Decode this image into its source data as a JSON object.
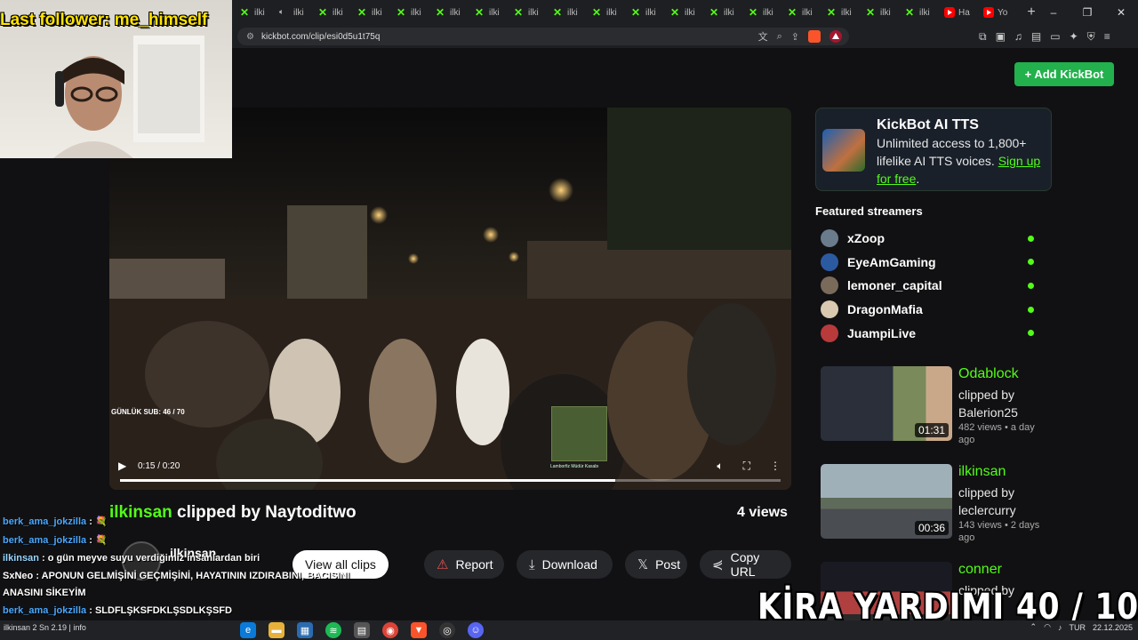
{
  "browser": {
    "tabs": [
      {
        "favicon": "kick-icon",
        "label": "ilki"
      },
      {
        "favicon": "speaker-icon",
        "label": "ilki"
      },
      {
        "favicon": "kick-icon",
        "label": "ilki"
      },
      {
        "favicon": "kick-icon",
        "label": "ilki"
      },
      {
        "favicon": "kick-icon",
        "label": "ilki"
      },
      {
        "favicon": "kick-icon",
        "label": "ilki"
      },
      {
        "favicon": "kick-icon",
        "label": "ilki"
      },
      {
        "favicon": "kick-icon",
        "label": "ilki"
      },
      {
        "favicon": "kick-icon",
        "label": "ilki"
      },
      {
        "favicon": "kick-icon",
        "label": "ilki"
      },
      {
        "favicon": "kick-icon",
        "label": "ilki"
      },
      {
        "favicon": "kick-icon",
        "label": "ilki"
      },
      {
        "favicon": "kick-icon",
        "label": "ilki"
      },
      {
        "favicon": "kick-icon",
        "label": "ilki"
      },
      {
        "favicon": "kick-icon",
        "label": "ilki"
      },
      {
        "favicon": "kick-icon",
        "label": "ilki"
      },
      {
        "favicon": "kick-icon",
        "label": "ilki"
      },
      {
        "favicon": "kick-icon",
        "label": "ilki"
      },
      {
        "favicon": "youtube-icon",
        "label": "Ha"
      },
      {
        "favicon": "youtube-icon",
        "label": "Yo"
      }
    ],
    "url": "kickbot.com/clip/esi0d5u1t75q"
  },
  "page": {
    "add_button": "+ Add KickBot",
    "video": {
      "time": "0:15 / 0:20",
      "progress": 0.75,
      "overlay_text": "GÜNLÜK SUB: 46 / 70",
      "overlay_caption": "Lamborfiz Müdür Kasabı"
    },
    "clip": {
      "channel": "ilkinsan",
      "clipped_by": "clipped by Naytoditwo",
      "views": "4 views",
      "creator": "ilkinsan"
    },
    "actions": {
      "view_all": "View all clips",
      "report": "Report",
      "download": "Download",
      "post": "Post",
      "copy_url": "Copy URL"
    },
    "tts": {
      "title": "KickBot AI TTS",
      "text": "Unlimited access to 1,800+ lifelike AI TTS voices. ",
      "link": "Sign up for free",
      "tail": "."
    },
    "featured_heading": "Featured streamers",
    "streamers": [
      {
        "name": "xZoop",
        "color": "#6a7b8c"
      },
      {
        "name": "EyeAmGaming",
        "color": "#2c5aa0"
      },
      {
        "name": "lemoner_capital",
        "color": "#7a6a5a"
      },
      {
        "name": "DragonMafia",
        "color": "#d8c9b0"
      },
      {
        "name": "JuampiLive",
        "color": "#b83a3a"
      }
    ],
    "related": [
      {
        "channel": "Odablock",
        "by": "clipped by Balerion25",
        "meta": "482 views • a day ago",
        "duration": "01:31"
      },
      {
        "channel": "ilkinsan",
        "by": "clipped by leclercurry",
        "meta": "143 views • 2 days ago",
        "duration": "00:36"
      },
      {
        "channel": "conner",
        "by": "clipped by",
        "meta": "",
        "duration": ""
      }
    ]
  },
  "stream": {
    "last_follower": "Last follower: me_himself",
    "goal": "KİRA YARDIMI  40 / 100",
    "chat": [
      {
        "user": "berk_ama_jokzilla",
        "msg": ": 💐"
      },
      {
        "user": "berk_ama_jokzilla",
        "msg": ": 💐"
      },
      {
        "user": "ilkinsan",
        "msg": ": o gün meyve suyu verdiğimiz insanlardan biri"
      },
      {
        "user": "SxNeo",
        "msg": ": APONUN GELMİŞİNİ GEÇMİŞİNİ, HAYATININ IZDIRABINI, BACISINI"
      },
      {
        "user": "",
        "msg": "ANASINI SİKEYİM"
      },
      {
        "user": "berk_ama_jokzilla",
        "msg": ": SLDFLŞKSFDKLŞSDLKŞSFD"
      }
    ]
  },
  "taskbar": {
    "left_text": "ilkinsan 2 Sn 2.19 | info",
    "lang": "TUR",
    "date": "22.12.2025"
  }
}
